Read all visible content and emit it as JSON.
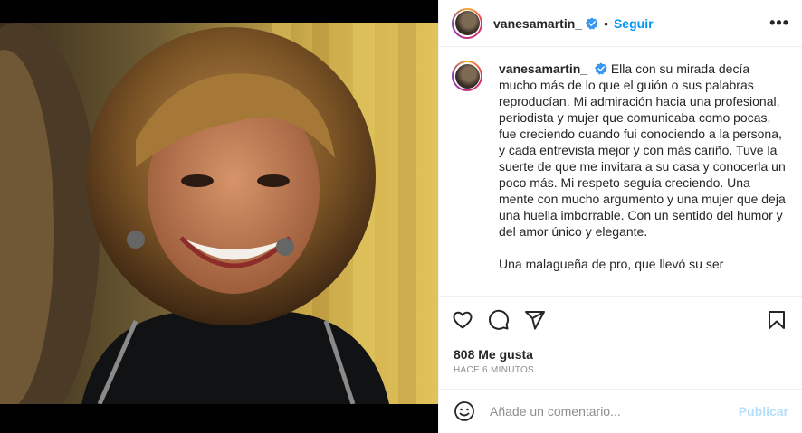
{
  "post": {
    "username": "vanesamartin_",
    "follow_label": "Seguir",
    "separator": "•",
    "more_label": "•••",
    "caption_p1": "Ella con su mirada decía mucho más de lo que el guión o sus palabras reproducían. Mi admiración hacia una profesional, periodista y mujer que comunicaba como pocas, fue creciendo cuando fui conociendo a la persona, y cada entrevista mejor y con más cariño. Tuve la suerte de que me invitara a su casa y conocerla un poco más. Mi respeto seguía creciendo. Una mente con mucho argumento y una mujer que deja una huella imborrable. Con un sentido del humor y del amor único y elegante.",
    "caption_p2": "Una malagueña de pro, que llevó su ser",
    "likes": "808 Me gusta",
    "time_ago": "HACE 6 MINUTOS"
  },
  "comment": {
    "placeholder": "Añade un comentario...",
    "publish_label": "Publicar"
  },
  "icons": {
    "verified": "verified-badge-icon",
    "like": "heart-icon",
    "comment": "comment-bubble-icon",
    "share": "paper-plane-icon",
    "save": "bookmark-icon",
    "emoji": "smiley-icon",
    "more": "more-options-icon"
  },
  "colors": {
    "accent": "#0095f6",
    "verified": "#3897f0",
    "publish_disabled": "#b2dffc",
    "muted": "#8e8e8e",
    "text": "#262626"
  }
}
